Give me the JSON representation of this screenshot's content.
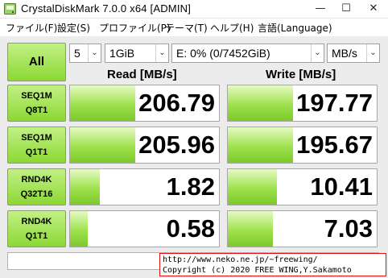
{
  "window": {
    "title": "CrystalDiskMark 7.0.0 x64 [ADMIN]",
    "minimize": "—",
    "maximize": "☐",
    "close": "✕"
  },
  "menu": {
    "items": [
      {
        "label": "ファイル(F)"
      },
      {
        "label": "設定(S)"
      },
      {
        "label": "プロファイル(P)"
      },
      {
        "label": "テーマ(T)"
      },
      {
        "label": "ヘルプ(H)"
      },
      {
        "label": "言語(Language)"
      }
    ]
  },
  "controls": {
    "all_label": "All",
    "count": "5",
    "size": "1GiB",
    "drive": "E: 0% (0/7452GiB)",
    "unit": "MB/s",
    "arrow": "⌄"
  },
  "headers": {
    "read": "Read [MB/s]",
    "write": "Write [MB/s]"
  },
  "tests": [
    {
      "line1": "SEQ1M",
      "line2": "Q8T1",
      "read": "206.79",
      "write": "197.77",
      "read_fraction": 0.44,
      "write_fraction": 0.44
    },
    {
      "line1": "SEQ1M",
      "line2": "Q1T1",
      "read": "205.96",
      "write": "195.67",
      "read_fraction": 0.44,
      "write_fraction": 0.44
    },
    {
      "line1": "RND4K",
      "line2": "Q32T16",
      "read": "1.82",
      "write": "10.41",
      "read_fraction": 0.2,
      "write_fraction": 0.33
    },
    {
      "line1": "RND4K",
      "line2": "Q1T1",
      "read": "0.58",
      "write": "7.03",
      "read_fraction": 0.12,
      "write_fraction": 0.3
    }
  ],
  "footer": {
    "comment": "",
    "copyright_line1": "http://www.neko.ne.jp/~freewing/",
    "copyright_line2": "Copyright (c) 2020 FREE WING,Y.Sakamoto"
  },
  "colors": {
    "accent_green": "#8cd834",
    "copyright_border": "#e01010"
  }
}
